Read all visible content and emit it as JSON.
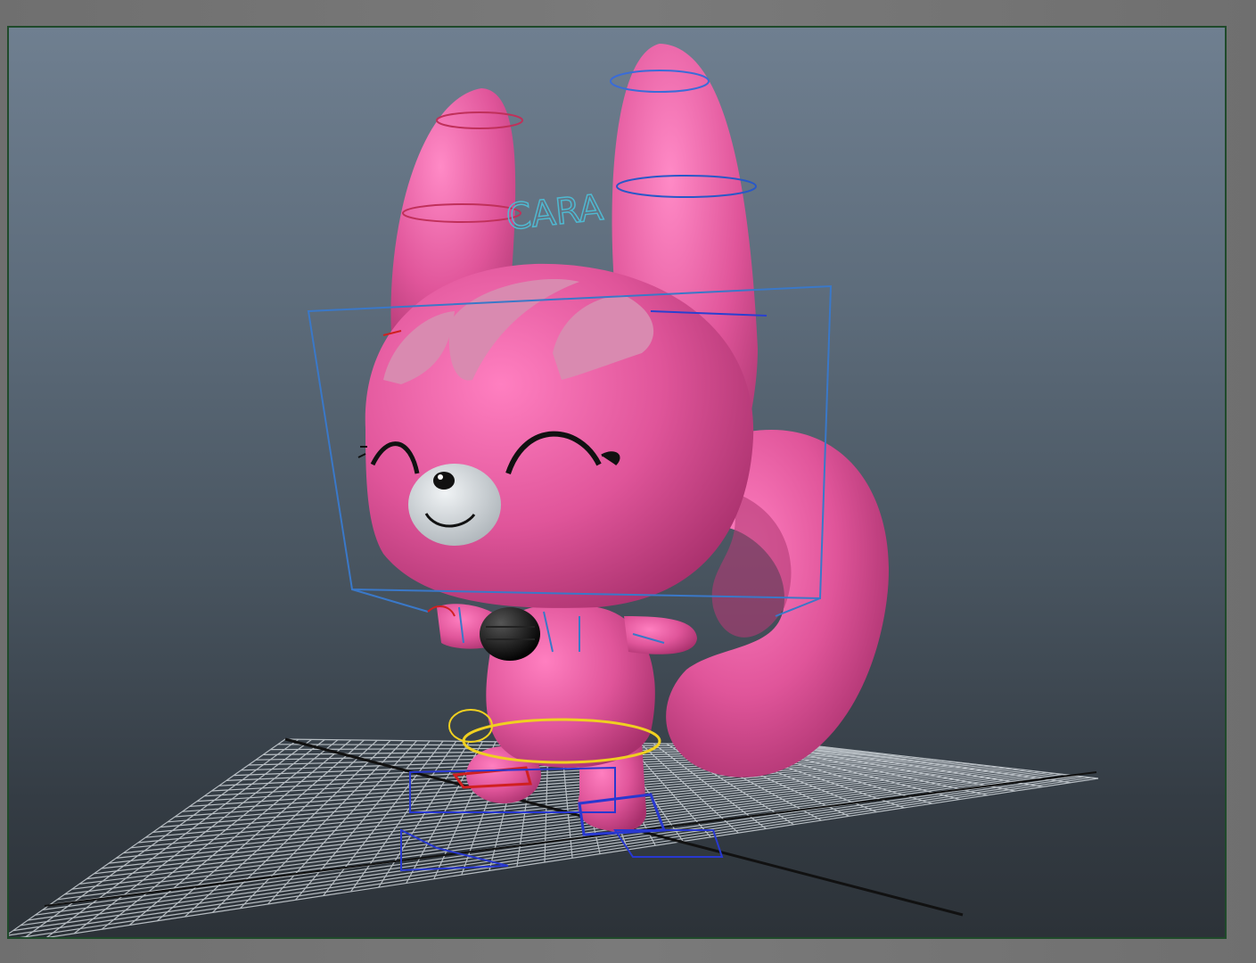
{
  "app": {
    "panel": "perspective-viewport"
  },
  "scene": {
    "character_label": "CARA",
    "body_color": "#e0559a",
    "patch_color": "#d98ab0",
    "muzzle_color": "#c9d0d4",
    "grid_color": "#cfd5da",
    "axis_color": "#111111",
    "viewport_border": "#1f4a2a"
  }
}
